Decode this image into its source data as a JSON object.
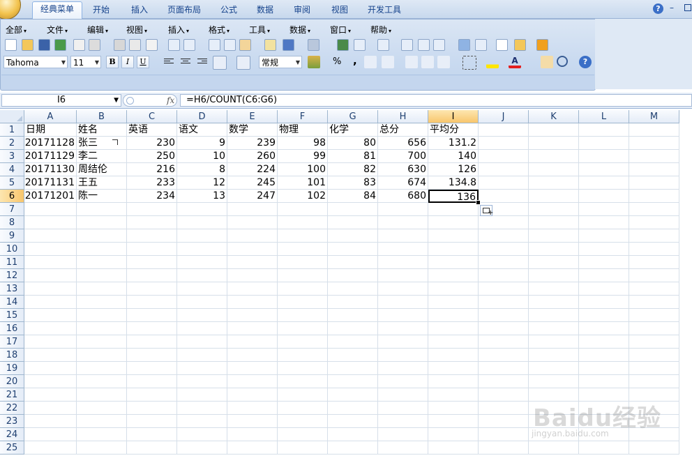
{
  "ribbon": {
    "tabs": [
      "经典菜单",
      "开始",
      "插入",
      "页面布局",
      "公式",
      "数据",
      "审阅",
      "视图",
      "开发工具"
    ],
    "active_tab": "经典菜单",
    "menus": [
      "全部",
      "文件",
      "编辑",
      "视图",
      "插入",
      "格式",
      "工具",
      "数据",
      "窗口",
      "帮助"
    ],
    "font_name": "Tahoma",
    "font_size": "11",
    "number_format": "常规",
    "bold_label": "B",
    "italic_label": "I",
    "underline_label": "U",
    "percent_label": "%",
    "comma_label": ",",
    "sum_label": "Σ",
    "fx_label": "fx",
    "help_label": "?"
  },
  "formula_bar": {
    "name_box": "I6",
    "fx_label": "fx",
    "formula": "=H6/COUNT(C6:G6)"
  },
  "sheet": {
    "columns": [
      "A",
      "B",
      "C",
      "D",
      "E",
      "F",
      "G",
      "H",
      "I",
      "J",
      "K",
      "L",
      "M"
    ],
    "rows": [
      "1",
      "2",
      "3",
      "4",
      "5",
      "6",
      "7",
      "8",
      "9",
      "10",
      "11",
      "12",
      "13",
      "14",
      "15",
      "16",
      "17",
      "18",
      "19",
      "20",
      "21",
      "22",
      "23",
      "24",
      "25"
    ],
    "active_cell": "I6",
    "header": [
      "日期",
      "姓名",
      "英语",
      "语文",
      "数学",
      "物理",
      "化学",
      "总分",
      "平均分"
    ],
    "data": [
      [
        "20171128",
        "张三",
        "230",
        "9",
        "239",
        "98",
        "80",
        "656",
        "131.2"
      ],
      [
        "20171129",
        "李二",
        "250",
        "10",
        "260",
        "99",
        "81",
        "700",
        "140"
      ],
      [
        "20171130",
        "周结伦",
        "216",
        "8",
        "224",
        "100",
        "82",
        "630",
        "126"
      ],
      [
        "20171131",
        "王五",
        "233",
        "12",
        "245",
        "101",
        "83",
        "674",
        "134.8"
      ],
      [
        "20171201",
        "陈一",
        "234",
        "13",
        "247",
        "102",
        "84",
        "680",
        "136"
      ]
    ]
  },
  "watermark": {
    "logo": "Baidu经验",
    "url": "jingyan.baidu.com"
  },
  "colors": {
    "ribbon_bg": "#c9daf0",
    "header_bg": "#e4ecf7",
    "selected_header": "#f8c66c",
    "gridline": "#d6dfe9"
  }
}
